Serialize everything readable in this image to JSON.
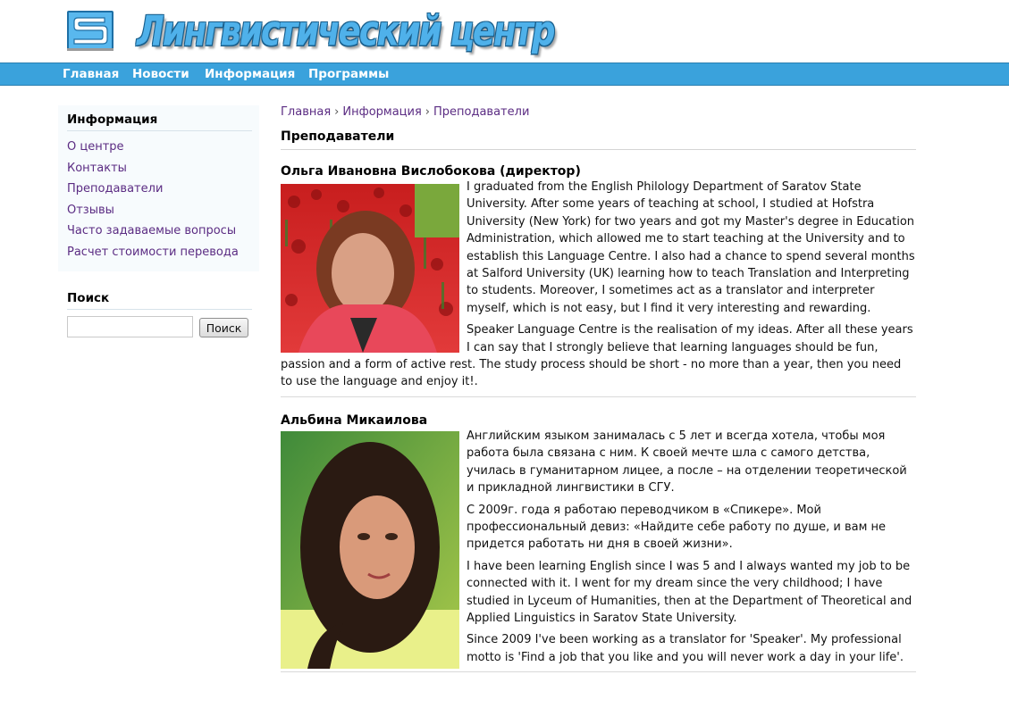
{
  "site": {
    "logo_letter": "S",
    "title": "Лингвистический центр",
    "brand_color": "#4fb1ea",
    "nav_color": "#3aa2dc"
  },
  "nav": {
    "items": [
      {
        "label": "Главная"
      },
      {
        "label": "Новости"
      },
      {
        "label": "Информация"
      },
      {
        "label": "Программы"
      }
    ]
  },
  "sidebar": {
    "info_heading": "Информация",
    "links": [
      {
        "label": "О центре"
      },
      {
        "label": "Контакты"
      },
      {
        "label": "Преподаватели"
      },
      {
        "label": "Отзывы"
      },
      {
        "label": "Часто задаваемые вопросы"
      },
      {
        "label": "Расчет стоимости перевода"
      }
    ],
    "search_heading": "Поиск",
    "search_value": "",
    "search_button": "Поиск"
  },
  "breadcrumb": {
    "items": [
      "Главная",
      "Информация",
      "Преподаватели"
    ],
    "separator": "›"
  },
  "page": {
    "title": "Преподаватели"
  },
  "people": [
    {
      "name": "Ольга Ивановна Вислобокова (директор)",
      "paragraphs": [
        "I graduated from the English Philology Department of Saratov State University. After some years of teaching at school, I studied at Hofstra University (New York) for two years and got my Master's degree in Education Administration, which allowed me to start teaching at the University and to establish this Language Centre. I also had a chance to spend several months at Salford University (UK) learning how to teach Translation and Interpreting to students. Moreover, I sometimes act as a translator and interpreter myself, which is not easy, but I find it very interesting and rewarding.",
        "Speaker Language Centre is the realisation of my ideas. After all these years I can say that I strongly believe that learning languages should be fun, passion and a form of active rest. The study process should be short - no more than a year, then you need to use the language and enjoy it!."
      ]
    },
    {
      "name": "Альбина Микаилова",
      "paragraphs": [
        "Английским языком занималась с 5 лет и всегда хотела, чтобы моя работа была связана с ним. К своей мечте шла с самого детства, училась в гуманитарном лицее, а после – на отделении теоретической и прикладной лингвистики в СГУ.",
        "С 2009г. года я работаю переводчиком в «Спикере». Мой профессиональный девиз: «Найдите себе работу по душе, и вам не придется работать ни дня в своей жизни».",
        "I have been learning English since I was 5 and I always wanted my job to be connected with it. I went for my dream since the very childhood; I have studied in Lyceum of Humanities, then at the Department of Theoretical and Applied Linguistics in Saratov State University.",
        "Since 2009 I've been working as a translator for 'Speaker'. My professional motto is 'Find a job that you like and you will never work a day in your life'."
      ]
    }
  ]
}
